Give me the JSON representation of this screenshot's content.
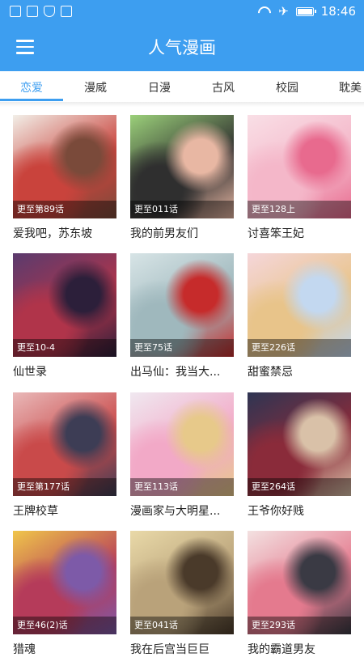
{
  "status_bar": {
    "time": "18:46",
    "battery": 1.0
  },
  "header": {
    "title": "人气漫画"
  },
  "tabs": [
    {
      "label": "恋爱",
      "active": true
    },
    {
      "label": "漫威",
      "active": false
    },
    {
      "label": "日漫",
      "active": false
    },
    {
      "label": "古风",
      "active": false
    },
    {
      "label": "校园",
      "active": false
    },
    {
      "label": "耽美",
      "active": false
    }
  ],
  "comics": [
    {
      "title": "爱我吧，苏东坡",
      "update": "更至第89话",
      "colors": [
        "#f2efe8",
        "#c9433c",
        "#7a4a3a"
      ]
    },
    {
      "title": "我的前男友们",
      "update": "更至011话",
      "colors": [
        "#9bd07a",
        "#2f2f2f",
        "#e8b7a3"
      ]
    },
    {
      "title": "讨喜笨王妃",
      "update": "更至128上",
      "colors": [
        "#f9dfe6",
        "#f4b7c9",
        "#e86a8e"
      ]
    },
    {
      "title": "仙世录",
      "update": "更至10-4",
      "colors": [
        "#5a3b6e",
        "#b0344a",
        "#2c1f3a"
      ]
    },
    {
      "title": "出马仙：我当大...",
      "update": "更至75话",
      "colors": [
        "#d7e4e6",
        "#9fb8bd",
        "#c62b2b"
      ]
    },
    {
      "title": "甜蜜禁忌",
      "update": "更至226话",
      "colors": [
        "#f5d6da",
        "#e8c48a",
        "#c3d8f0"
      ]
    },
    {
      "title": "王牌校草",
      "update": "更至第177话",
      "colors": [
        "#e9b8b8",
        "#c94a4a",
        "#3d3d55"
      ]
    },
    {
      "title": "漫画家与大明星...",
      "update": "更至113话",
      "colors": [
        "#f0e8f0",
        "#f2a9c7",
        "#e7c98a"
      ]
    },
    {
      "title": "王爷你好贱",
      "update": "更至264话",
      "colors": [
        "#2e3553",
        "#8a2b3a",
        "#d9c1a8"
      ]
    },
    {
      "title": "猎魂",
      "update": "更至46(2)话",
      "colors": [
        "#f0c64a",
        "#b53b5a",
        "#7d5aa8"
      ]
    },
    {
      "title": "我在后宫当巨巨",
      "update": "更至041话",
      "colors": [
        "#e9d9a8",
        "#b9a27a",
        "#4a3a2a"
      ]
    },
    {
      "title": "我的霸道男友",
      "update": "更至293话",
      "colors": [
        "#f3e1e1",
        "#e47a8e",
        "#3a3a44"
      ]
    }
  ]
}
